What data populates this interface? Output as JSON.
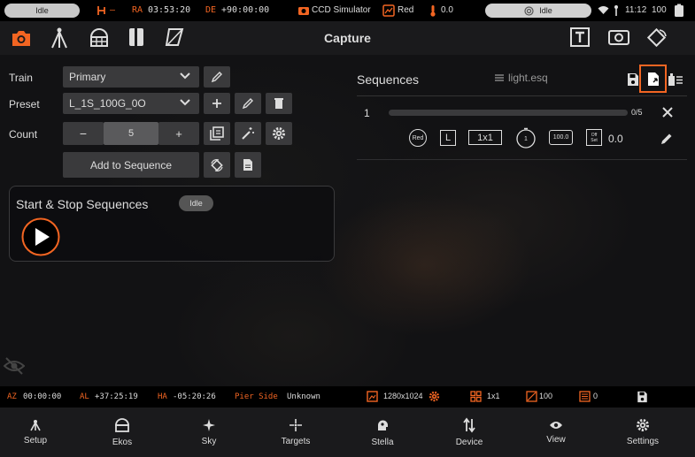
{
  "status": {
    "idle_left": "Idle",
    "mount_dash": "–",
    "ra_label": "RA",
    "ra_value": "03:53:20",
    "de_label": "DE",
    "de_value": "+90:00:00",
    "camera": "CCD Simulator",
    "filter": "Red",
    "temp": "0.0",
    "idle_right": "Idle",
    "time": "11:12",
    "battery": "100"
  },
  "toolbar": {
    "title": "Capture"
  },
  "form": {
    "train_label": "Train",
    "train_value": "Primary",
    "preset_label": "Preset",
    "preset_value": "L_1S_100G_0O",
    "count_label": "Count",
    "count_minus": "−",
    "count_value": "5",
    "count_plus": "+",
    "add_label": "Add to Sequence"
  },
  "startstop": {
    "title": "Start & Stop Sequences",
    "badge": "Idle"
  },
  "sequences": {
    "title": "Sequences",
    "file": "light.esq",
    "row": {
      "index": "1",
      "progress_text": "0/5",
      "progress": 0,
      "filter_badge": "Red",
      "type_badge": "L",
      "binning": "1x1",
      "exposure": "1",
      "gain": "100.0",
      "offset_top": "Off",
      "offset_bottom": "Set",
      "offset_value": "0.0"
    }
  },
  "infobar": {
    "az_label": "AZ",
    "az_value": "00:00:00",
    "al_label": "AL",
    "al_value": "+37:25:19",
    "ha_label": "HA",
    "ha_value": "-05:20:26",
    "pier_label": "Pier Side",
    "pier_value": "Unknown",
    "resolution": "1280x1024",
    "bin": "1x1",
    "gain": "100",
    "offset": "0"
  },
  "nav": [
    {
      "label": "Setup"
    },
    {
      "label": "Ekos"
    },
    {
      "label": "Sky"
    },
    {
      "label": "Targets"
    },
    {
      "label": "Stella"
    },
    {
      "label": "Device"
    },
    {
      "label": "View"
    },
    {
      "label": "Settings"
    }
  ],
  "colors": {
    "accent": "#f26522",
    "panel": "#3a3a3c",
    "bar": "#000000"
  }
}
